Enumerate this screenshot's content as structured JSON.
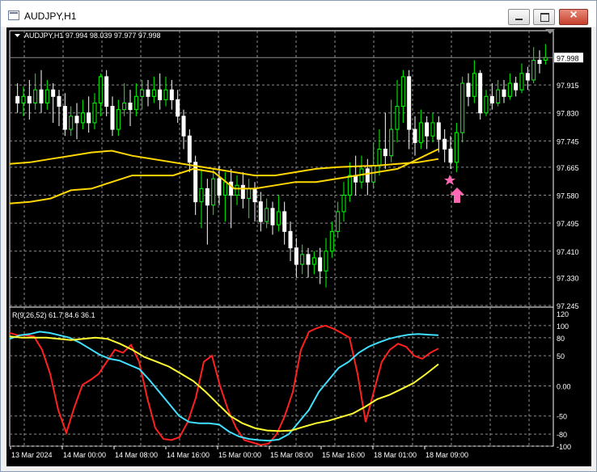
{
  "window": {
    "title": "AUDJPY,H1"
  },
  "chart_data": [
    {
      "type": "candlestick",
      "symbol_label": "AUDJPY,H1",
      "ohlc_label": "97.994 98.039 97.977 97.998",
      "current_price": "97.998",
      "y_ticks": [
        "97.915",
        "97.830",
        "97.745",
        "97.665",
        "97.580",
        "97.495",
        "97.410",
        "97.330",
        "97.245"
      ],
      "ylim": [
        97.245,
        98.06
      ],
      "colors": {
        "bull": "#00ff00",
        "bear": "#ffffff",
        "ma_fast": "#ffd700",
        "ma_slow": "#ffd700"
      },
      "candles": [
        [
          97.88,
          97.86,
          97.92,
          97.83
        ],
        [
          97.86,
          97.88,
          97.91,
          97.82
        ],
        [
          97.88,
          97.86,
          97.93,
          97.81
        ],
        [
          97.86,
          97.9,
          97.95,
          97.84
        ],
        [
          97.9,
          97.86,
          97.96,
          97.83
        ],
        [
          97.86,
          97.9,
          97.93,
          97.84
        ],
        [
          97.9,
          97.88,
          97.92,
          97.8
        ],
        [
          97.88,
          97.85,
          97.9,
          97.79
        ],
        [
          97.85,
          97.78,
          97.89,
          97.76
        ],
        [
          97.78,
          97.82,
          97.85,
          97.76
        ],
        [
          97.82,
          97.8,
          97.86,
          97.75
        ],
        [
          97.8,
          97.83,
          97.87,
          97.78
        ],
        [
          97.83,
          97.8,
          97.88,
          97.77
        ],
        [
          97.8,
          97.86,
          97.89,
          97.78
        ],
        [
          97.86,
          97.94,
          97.95,
          97.82
        ],
        [
          97.94,
          97.85,
          97.96,
          97.82
        ],
        [
          97.85,
          97.78,
          97.88,
          97.76
        ],
        [
          97.78,
          97.84,
          97.87,
          97.76
        ],
        [
          97.84,
          97.86,
          97.92,
          97.82
        ],
        [
          97.86,
          97.84,
          97.9,
          97.79
        ],
        [
          97.84,
          97.88,
          97.92,
          97.82
        ],
        [
          97.88,
          97.9,
          97.93,
          97.84
        ],
        [
          97.9,
          97.88,
          97.93,
          97.85
        ],
        [
          97.88,
          97.9,
          97.94,
          97.86
        ],
        [
          97.9,
          97.87,
          97.95,
          97.84
        ],
        [
          97.87,
          97.9,
          97.94,
          97.85
        ],
        [
          97.9,
          97.87,
          97.93,
          97.84
        ],
        [
          97.87,
          97.82,
          97.9,
          97.8
        ],
        [
          97.82,
          97.76,
          97.84,
          97.72
        ],
        [
          97.76,
          97.68,
          97.78,
          97.65
        ],
        [
          97.68,
          97.56,
          97.7,
          97.52
        ],
        [
          97.56,
          97.6,
          97.66,
          97.48
        ],
        [
          97.6,
          97.55,
          97.63,
          97.43
        ],
        [
          97.55,
          97.63,
          97.66,
          97.52
        ],
        [
          97.63,
          97.58,
          97.67,
          97.55
        ],
        [
          97.58,
          97.62,
          97.65,
          97.5
        ],
        [
          97.62,
          97.58,
          97.66,
          97.48
        ],
        [
          97.58,
          97.61,
          97.64,
          97.55
        ],
        [
          97.61,
          97.57,
          97.65,
          97.54
        ],
        [
          97.57,
          97.6,
          97.63,
          97.51
        ],
        [
          97.6,
          97.56,
          97.62,
          97.5
        ],
        [
          97.56,
          97.5,
          97.59,
          97.47
        ],
        [
          97.5,
          97.54,
          97.57,
          97.48
        ],
        [
          97.54,
          97.49,
          97.56,
          97.46
        ],
        [
          97.49,
          97.53,
          97.58,
          97.47
        ],
        [
          97.53,
          97.47,
          97.56,
          97.43
        ],
        [
          97.47,
          97.42,
          97.5,
          97.38
        ],
        [
          97.42,
          97.37,
          97.45,
          97.33
        ],
        [
          97.37,
          97.4,
          97.43,
          97.34
        ],
        [
          97.4,
          97.37,
          97.42,
          97.33
        ],
        [
          97.37,
          97.39,
          97.41,
          97.34
        ],
        [
          97.39,
          97.35,
          97.42,
          97.31
        ],
        [
          97.35,
          97.41,
          97.45,
          97.3
        ],
        [
          97.41,
          97.47,
          97.5,
          97.39
        ],
        [
          97.47,
          97.53,
          97.56,
          97.45
        ],
        [
          97.53,
          97.58,
          97.62,
          97.5
        ],
        [
          97.58,
          97.64,
          97.68,
          97.56
        ],
        [
          97.64,
          97.62,
          97.7,
          97.58
        ],
        [
          97.62,
          97.66,
          97.7,
          97.6
        ],
        [
          97.66,
          97.62,
          97.69,
          97.58
        ],
        [
          97.62,
          97.67,
          97.74,
          97.6
        ],
        [
          97.67,
          97.72,
          97.78,
          97.64
        ],
        [
          97.72,
          97.7,
          97.83,
          97.66
        ],
        [
          97.7,
          97.78,
          97.87,
          97.68
        ],
        [
          97.78,
          97.85,
          97.93,
          97.74
        ],
        [
          97.85,
          97.94,
          97.96,
          97.8
        ],
        [
          97.94,
          97.78,
          97.96,
          97.72
        ],
        [
          97.78,
          97.74,
          97.82,
          97.7
        ],
        [
          97.74,
          97.8,
          97.84,
          97.72
        ],
        [
          97.8,
          97.76,
          97.82,
          97.72
        ],
        [
          97.76,
          97.8,
          97.83,
          97.74
        ],
        [
          97.8,
          97.75,
          97.82,
          97.71
        ],
        [
          97.75,
          97.72,
          97.78,
          97.68
        ],
        [
          97.72,
          97.68,
          97.76,
          97.66
        ],
        [
          97.68,
          97.77,
          97.8,
          97.65
        ],
        [
          97.77,
          97.92,
          97.94,
          97.74
        ],
        [
          97.92,
          97.88,
          97.95,
          97.85
        ],
        [
          97.88,
          97.95,
          97.99,
          97.86
        ],
        [
          97.95,
          97.83,
          97.96,
          97.81
        ],
        [
          97.83,
          97.88,
          97.9,
          97.82
        ],
        [
          97.88,
          97.86,
          97.92,
          97.84
        ],
        [
          97.86,
          97.9,
          97.93,
          97.85
        ],
        [
          97.9,
          97.88,
          97.93,
          97.86
        ],
        [
          97.88,
          97.92,
          97.95,
          97.87
        ],
        [
          97.92,
          97.9,
          97.94,
          97.88
        ],
        [
          97.9,
          97.95,
          97.98,
          97.89
        ],
        [
          97.95,
          97.93,
          97.97,
          97.9
        ],
        [
          97.93,
          97.99,
          98.03,
          97.92
        ],
        [
          97.99,
          97.98,
          98.02,
          97.95
        ],
        [
          97.99,
          97.998,
          98.039,
          97.977
        ]
      ],
      "ma_fast": [
        97.675,
        97.68,
        97.69,
        97.7,
        97.71,
        97.715,
        97.7,
        97.69,
        97.68,
        97.67,
        97.66,
        97.65,
        97.64,
        97.64,
        97.65,
        97.66,
        97.665,
        97.668,
        97.67,
        97.675,
        97.68,
        97.69
      ],
      "ma_slow": [
        97.555,
        97.56,
        97.57,
        97.595,
        97.6,
        97.62,
        97.64,
        97.64,
        97.64,
        97.66,
        97.65,
        97.6,
        97.6,
        97.61,
        97.62,
        97.62,
        97.63,
        97.64,
        97.65,
        97.66,
        97.69,
        97.72
      ],
      "arrow_signal_index": 73
    },
    {
      "type": "line",
      "indicator_label": "R(9,26,52) 61.7 84.6 36.1",
      "y_ticks": [
        "120",
        "100",
        "80",
        "50",
        "0.00",
        "-50",
        "-80",
        "-100"
      ],
      "ylim": [
        -100,
        120
      ],
      "x_ticks": [
        "13 Mar 2024",
        "14 Mar 00:00",
        "14 Mar 08:00",
        "14 Mar 16:00",
        "15 Mar 00:00",
        "15 Mar 08:00",
        "15 Mar 16:00",
        "18 Mar 01:00",
        "18 Mar 09:00"
      ],
      "series": [
        {
          "color": "#ff2020",
          "values": [
            88,
            84,
            84,
            82,
            60,
            20,
            -40,
            -78,
            -35,
            2,
            10,
            20,
            40,
            60,
            55,
            68,
            40,
            -20,
            -70,
            -88,
            -90,
            -85,
            -60,
            -20,
            40,
            50,
            0,
            -40,
            -70,
            -90,
            -94,
            -98,
            -96,
            -80,
            -50,
            -10,
            60,
            90,
            96,
            100,
            95,
            88,
            80,
            20,
            -60,
            -10,
            40,
            60,
            70,
            65,
            50,
            45,
            55,
            62
          ]
        },
        {
          "color": "#40e0ff",
          "values": [
            78,
            84,
            86,
            90,
            88,
            84,
            80,
            72,
            62,
            52,
            45,
            42,
            35,
            28,
            10,
            -10,
            -30,
            -50,
            -60,
            -62,
            -62,
            -64,
            -76,
            -84,
            -88,
            -90,
            -91,
            -89,
            -80,
            -60,
            -40,
            -10,
            10,
            30,
            40,
            55,
            65,
            72,
            78,
            82,
            85,
            86,
            85,
            84
          ]
        },
        {
          "color": "#ffff30",
          "values": [
            82,
            80,
            80,
            80,
            78,
            76,
            78,
            80,
            78,
            70,
            60,
            48,
            40,
            32,
            20,
            8,
            -10,
            -30,
            -50,
            -62,
            -70,
            -74,
            -75,
            -74,
            -68,
            -62,
            -58,
            -52,
            -46,
            -35,
            -22,
            -15,
            -5,
            5,
            20,
            36
          ]
        }
      ]
    }
  ]
}
